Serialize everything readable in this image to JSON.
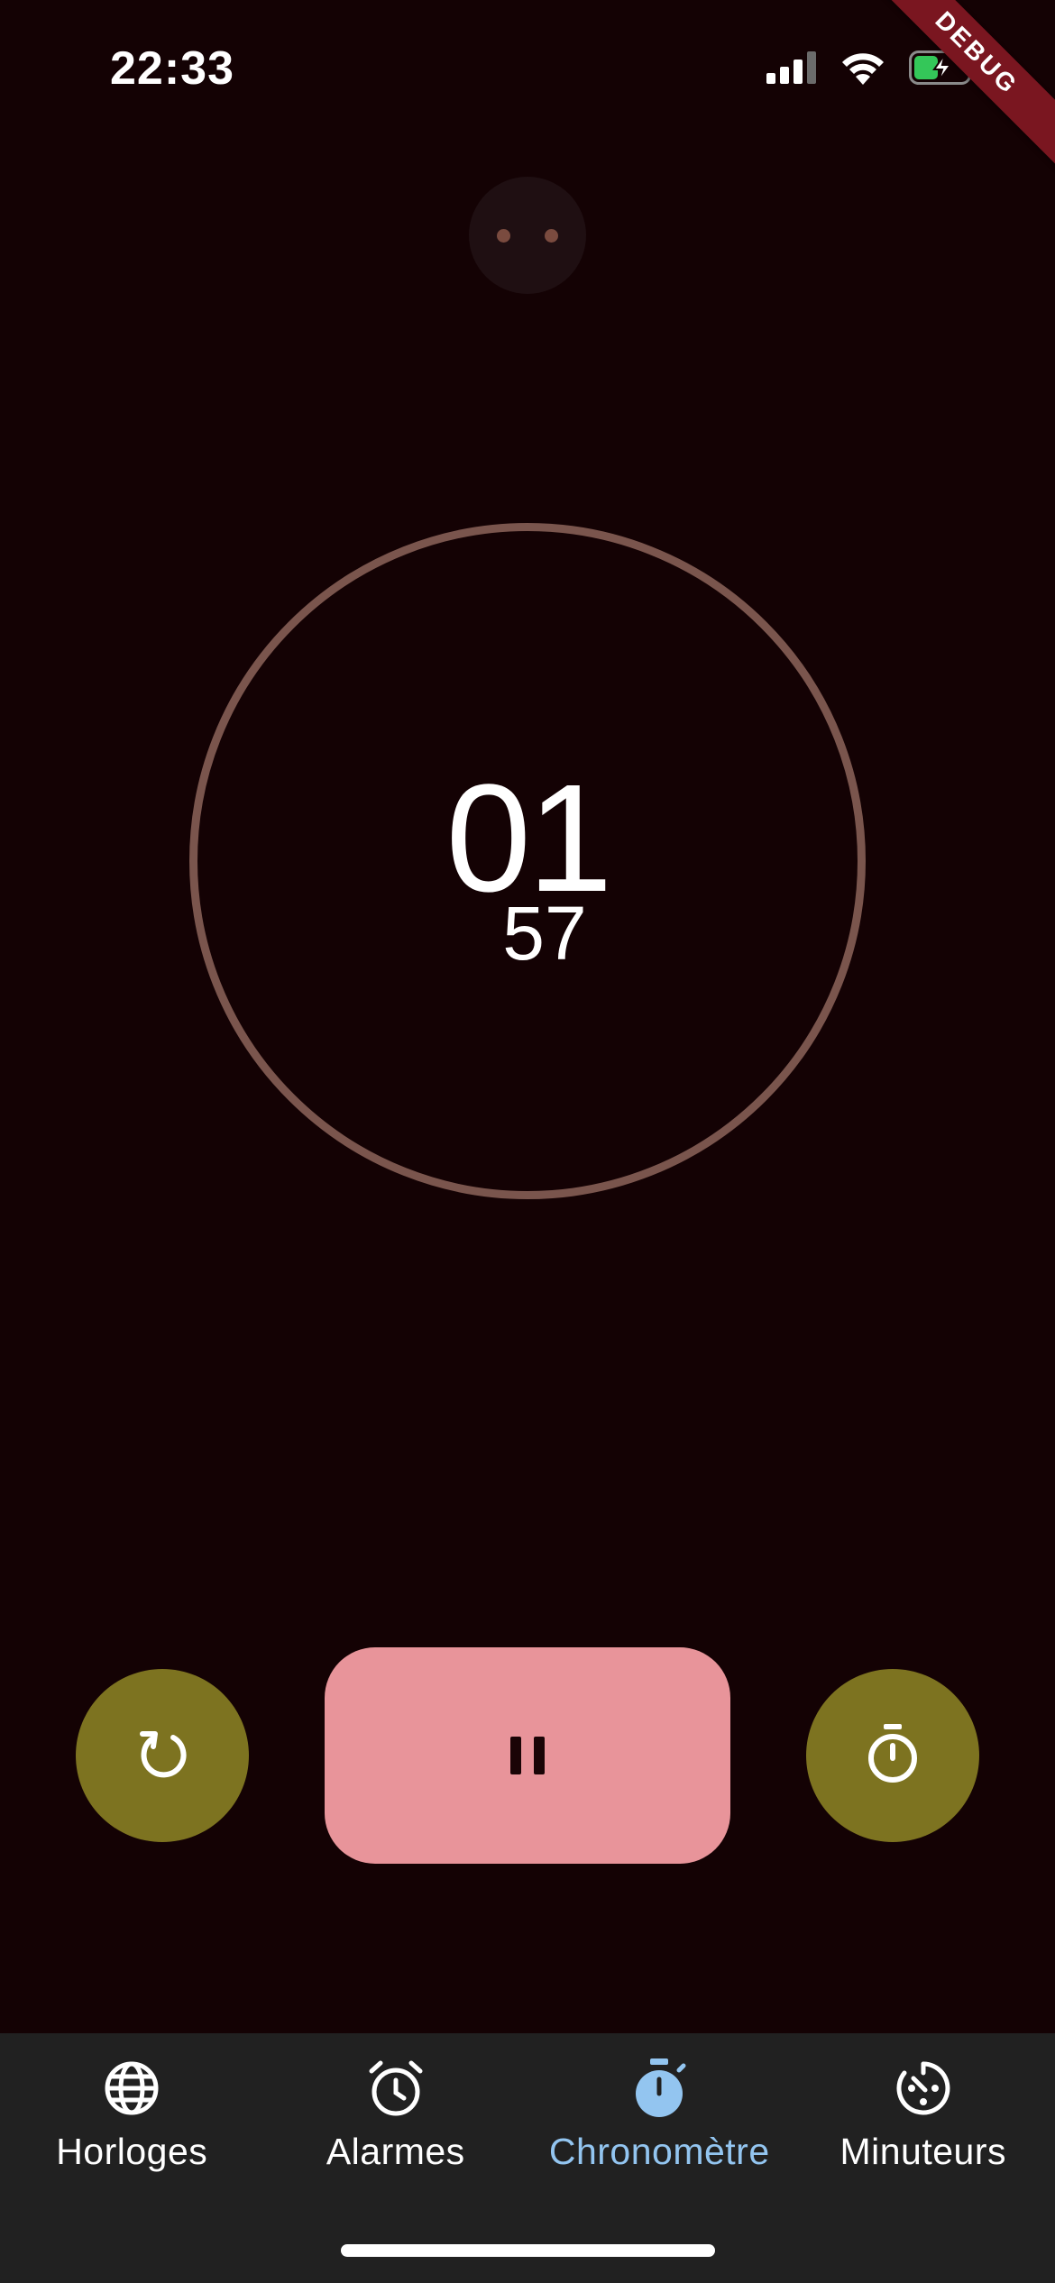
{
  "status_bar": {
    "time": "22:33"
  },
  "debug_banner": "DEBUG",
  "stopwatch": {
    "minutes": "01",
    "seconds": "57"
  },
  "controls": {
    "reset_icon": "reset-icon",
    "pause_icon": "pause-icon",
    "lap_icon": "stopwatch-icon"
  },
  "nav": {
    "items": [
      {
        "label": "Horloges",
        "icon": "globe-icon"
      },
      {
        "label": "Alarmes",
        "icon": "alarm-icon"
      },
      {
        "label": "Chronomètre",
        "icon": "stopwatch-icon",
        "active": true
      },
      {
        "label": "Minuteurs",
        "icon": "timer-icon"
      }
    ]
  },
  "colors": {
    "background": "#140204",
    "dial": "#7a554d",
    "round_button": "#7d7320",
    "pause_button": "#e8949a",
    "nav_background": "#212121",
    "nav_active": "#93c5f0"
  }
}
